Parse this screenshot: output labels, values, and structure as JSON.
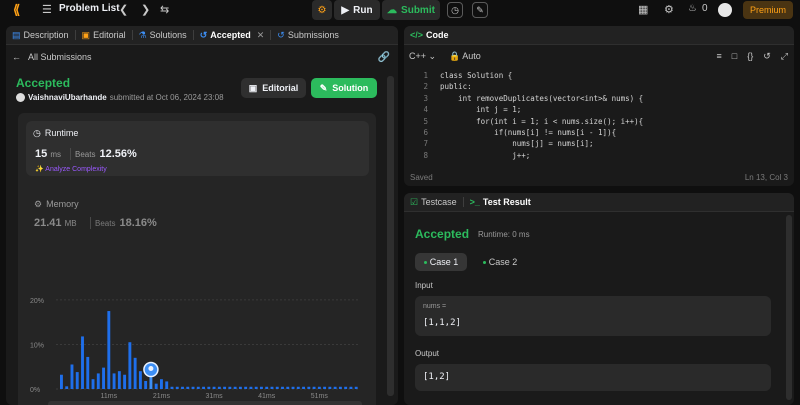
{
  "topbar": {
    "title": "Problem List",
    "run_label": "Run",
    "submit_label": "Submit",
    "streak_count": "0",
    "premium_label": "Premium"
  },
  "left_tabs": [
    {
      "label": "Description"
    },
    {
      "label": "Editorial"
    },
    {
      "label": "Solutions"
    },
    {
      "label": "Accepted"
    },
    {
      "label": "Submissions"
    }
  ],
  "submission": {
    "back_label": "All Submissions",
    "status": "Accepted",
    "username": "VaishnaviUbarhande",
    "submitted_text": "submitted at Oct 06, 2024 23:08",
    "editorial_label": "Editorial",
    "solution_label": "Solution",
    "runtime_label": "Runtime",
    "runtime_value": "15",
    "runtime_unit": "ms",
    "beats_label": "Beats",
    "runtime_beats": "12.56%",
    "analyze_label": "Analyze Complexity",
    "memory_label": "Memory",
    "memory_value": "21.41",
    "memory_unit": "MB",
    "memory_beats": "18.16%"
  },
  "chart_data": {
    "type": "bar",
    "ylabel_ticks": [
      "20%",
      "10%",
      "0%"
    ],
    "xlabel_ticks": [
      "11ms",
      "21ms",
      "31ms",
      "41ms",
      "51ms"
    ],
    "ylim": [
      0,
      22
    ],
    "values": [
      3.2,
      0.6,
      5.5,
      3.8,
      11.8,
      7.2,
      2.2,
      3.5,
      4.8,
      17.5,
      3.5,
      4.0,
      3.2,
      10.5,
      7.0,
      4.0,
      1.8,
      2.8,
      1.2,
      2.2,
      1.7,
      0.5,
      0.5,
      0.5,
      0.5,
      0.5,
      0.5,
      0.5,
      0.5,
      0.5,
      0.5,
      0.5,
      0.5,
      0.5,
      0.5,
      0.5,
      0.5,
      0.5,
      0.5,
      0.5,
      0.5,
      0.5,
      0.5,
      0.5,
      0.5,
      0.5,
      0.5,
      0.5,
      0.5,
      0.5,
      0.5,
      0.5,
      0.5,
      0.5,
      0.5,
      0.5,
      0.5
    ],
    "highlight_index": 17,
    "bar_color": "#1f6feb",
    "highlight_color": "#3d8ff5"
  },
  "code_panel": {
    "tab_label": "Code",
    "language": "C++",
    "mode": "Auto",
    "saved_label": "Saved",
    "cursor": "Ln 13, Col 3",
    "lines": [
      {
        "n": "1",
        "text": "class Solution {"
      },
      {
        "n": "2",
        "text": "public:"
      },
      {
        "n": "3",
        "text": "    int removeDuplicates(vector<int>& nums) {"
      },
      {
        "n": "4",
        "text": "        int j = 1;"
      },
      {
        "n": "5",
        "text": "        for(int i = 1; i < nums.size(); i++){"
      },
      {
        "n": "6",
        "text": "            if(nums[i] != nums[i - 1]){"
      },
      {
        "n": "7",
        "text": "                nums[j] = nums[i];"
      },
      {
        "n": "8",
        "text": "                j++;"
      }
    ]
  },
  "result_panel": {
    "testcase_label": "Testcase",
    "result_label": "Test Result",
    "status": "Accepted",
    "runtime_text": "Runtime: 0 ms",
    "case1_label": "Case 1",
    "case2_label": "Case 2",
    "input_label": "Input",
    "input_var": "nums =",
    "input_value": "[1,1,2]",
    "output_label": "Output",
    "output_value": "[1,2]"
  }
}
